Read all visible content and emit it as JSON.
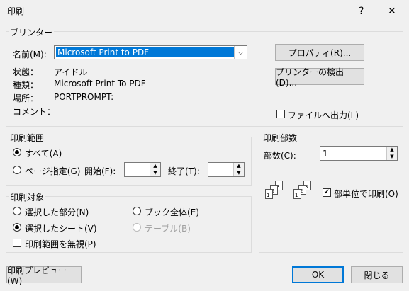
{
  "window": {
    "title": "印刷",
    "help": "?",
    "close": "✕"
  },
  "printer": {
    "legend": "プリンター",
    "name_label": "名前(M):",
    "name_value": "Microsoft Print to PDF",
    "status_label": "状態：",
    "status_value": "アイドル",
    "type_label": "種類：",
    "type_value": "Microsoft Print To PDF",
    "where_label": "場所：",
    "where_value": "PORTPROMPT:",
    "comment_label": "コメント：",
    "properties_button": "プロパティ(R)...",
    "find_button": "プリンターの検出(D)...",
    "print_to_file": "ファイルへ出力(L)"
  },
  "range": {
    "legend": "印刷範囲",
    "all": "すべて(A)",
    "pages": "ページ指定(G)",
    "from_label": "開始(F):",
    "to_label": "終了(T):"
  },
  "copies": {
    "legend": "印刷部数",
    "count_label": "部数(C):",
    "count_value": "1",
    "collate": "部単位で印刷(O)"
  },
  "target": {
    "legend": "印刷対象",
    "selection": "選択した部分(N)",
    "whole_book": "ブック全体(E)",
    "active_sheets": "選択したシート(V)",
    "table": "テーブル(B)",
    "ignore_areas": "印刷範囲を無視(P)"
  },
  "footer": {
    "preview": "印刷プレビュー(W)",
    "ok": "OK",
    "close": "閉じる"
  }
}
